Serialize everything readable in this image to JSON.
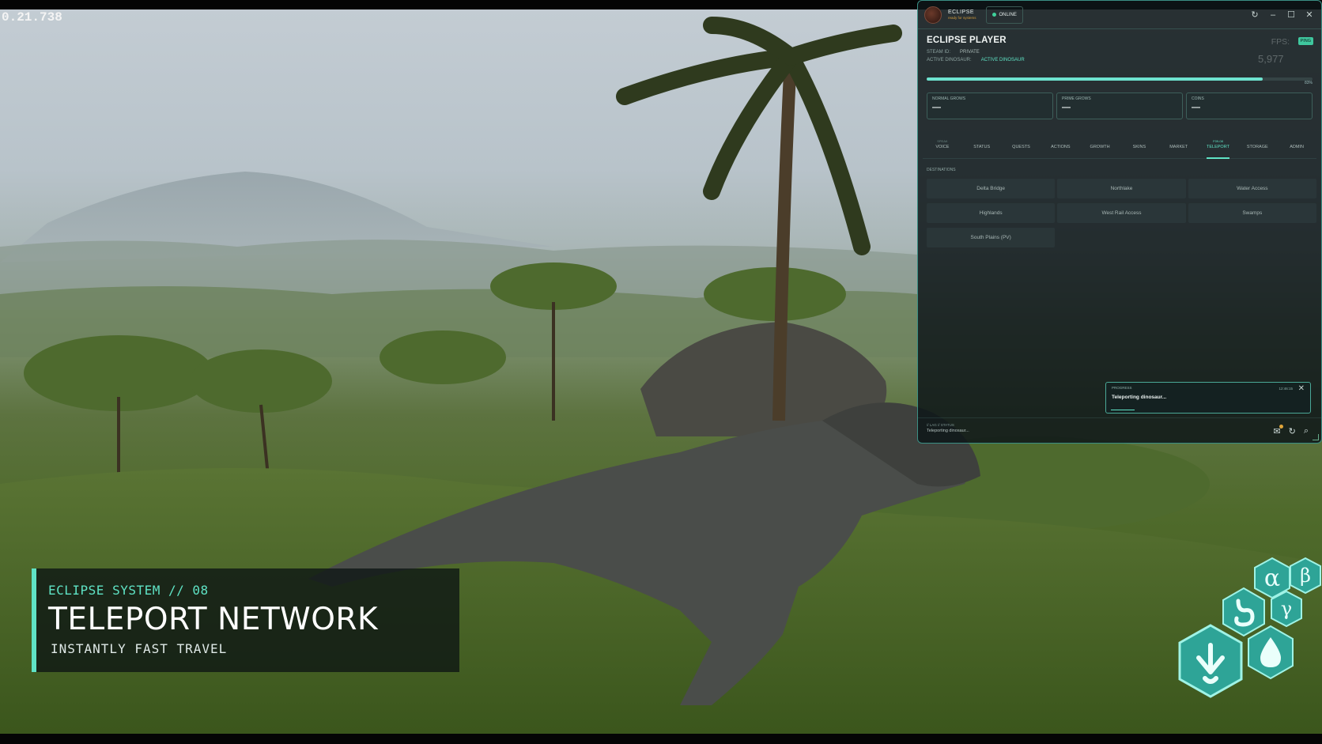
{
  "timer": "0.21.738",
  "panel": {
    "brand_name": "ECLIPSE",
    "brand_tagline": "ready for systems",
    "online_label": "ONLINE",
    "window_controls": [
      "refresh-icon",
      "minimize-icon",
      "maximize-icon",
      "close-icon"
    ],
    "player_title": "ECLIPSE PLAYER",
    "steam_label": "STEAM ID:",
    "steam_value": "PRIVATE",
    "dino_label": "ACTIVE DINOSAUR:",
    "dino_value": "ACTIVE DINOSAUR",
    "fps_label": "FPS:",
    "ping_label": "PING",
    "fps_value": "5,977",
    "progress": 0.87,
    "progress_pct": "83%",
    "stats": [
      {
        "label": "NORMAL GROWS",
        "value": "—"
      },
      {
        "label": "PRIME GROWS",
        "value": "—"
      },
      {
        "label": "COINS",
        "value": "—"
      }
    ],
    "tabs": [
      {
        "label": "VOICE",
        "sup": "SPEAK"
      },
      {
        "label": "STATUS",
        "sup": ""
      },
      {
        "label": "QUESTS",
        "sup": ""
      },
      {
        "label": "ACTIONS",
        "sup": ""
      },
      {
        "label": "GROWTH",
        "sup": ""
      },
      {
        "label": "SKINS",
        "sup": ""
      },
      {
        "label": "MARKET",
        "sup": ""
      },
      {
        "label": "TELEPORT",
        "sup": "F09-08",
        "active": true
      },
      {
        "label": "STORAGE",
        "sup": ""
      },
      {
        "label": "ADMIN",
        "sup": ""
      }
    ],
    "destinations_label": "DESTINATIONS",
    "destinations": [
      "Delta Bridge",
      "Northlake",
      "Water Access",
      "Highlands",
      "West Rail Access",
      "Swamps",
      "South Plains (PV)"
    ],
    "toast": {
      "title": "PROGRESS",
      "time": "12:46:15",
      "message": "Teleporting dinosaur..."
    },
    "footer_label": "// LAG // STATUS",
    "footer_status": "Teleporting dinosaur...",
    "footer_icons": [
      "chat-icon",
      "refresh-icon",
      "search-icon"
    ]
  },
  "caption": {
    "eyebrow": "ECLIPSE SYSTEM  //  08",
    "title": "TELEPORT NETWORK",
    "subtitle": "INSTANTLY FAST TRAVEL"
  },
  "abilities": [
    {
      "name": "alpha",
      "glyph": "α"
    },
    {
      "name": "beta",
      "glyph": "β"
    },
    {
      "name": "gamma",
      "glyph": "γ"
    },
    {
      "name": "stomach",
      "glyph": "stomach-icon"
    },
    {
      "name": "footprint",
      "glyph": "footprint-icon"
    },
    {
      "name": "water",
      "glyph": "water-drop-icon"
    }
  ],
  "colors": {
    "accent": "#5fe3c5",
    "panel_border": "#3a8f84",
    "online": "#3fd29b"
  }
}
